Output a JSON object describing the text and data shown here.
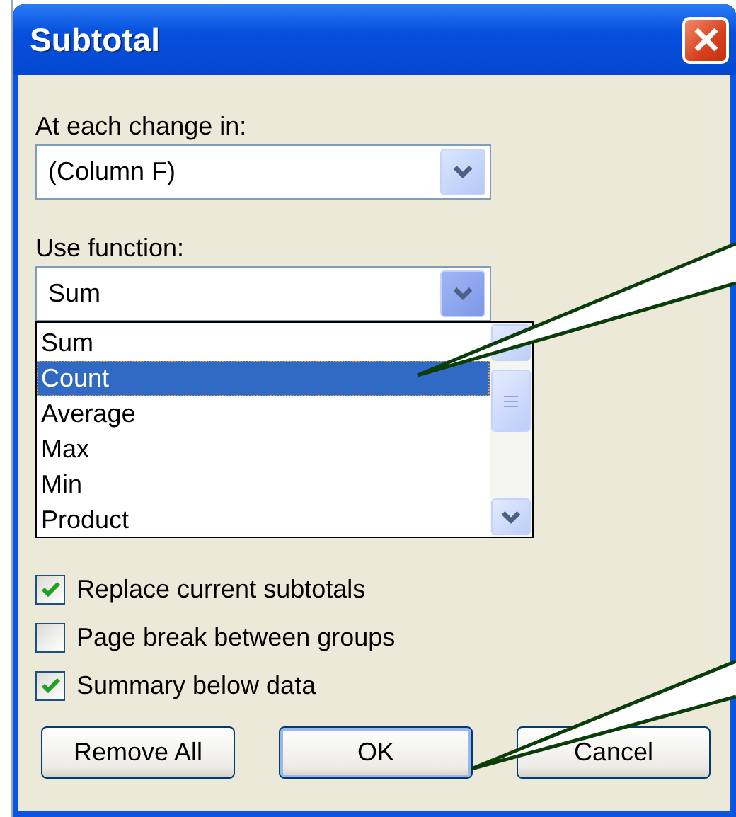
{
  "window": {
    "title": "Subtotal"
  },
  "change_field": {
    "label": "At each change in:",
    "value": "(Column F)"
  },
  "function_field": {
    "label": "Use function:",
    "value": "Sum",
    "expanded": true
  },
  "function_options": [
    {
      "label": "Sum",
      "selected": false
    },
    {
      "label": "Count",
      "selected": true
    },
    {
      "label": "Average",
      "selected": false
    },
    {
      "label": "Max",
      "selected": false
    },
    {
      "label": "Min",
      "selected": false
    },
    {
      "label": "Product",
      "selected": false
    }
  ],
  "options": [
    {
      "label": "Replace current subtotals",
      "checked": true
    },
    {
      "label": "Page break between groups",
      "checked": false
    },
    {
      "label": "Summary below data",
      "checked": true
    }
  ],
  "buttons": [
    {
      "label": "Remove All",
      "default": false
    },
    {
      "label": "OK",
      "default": true
    },
    {
      "label": "Cancel",
      "default": false
    }
  ]
}
